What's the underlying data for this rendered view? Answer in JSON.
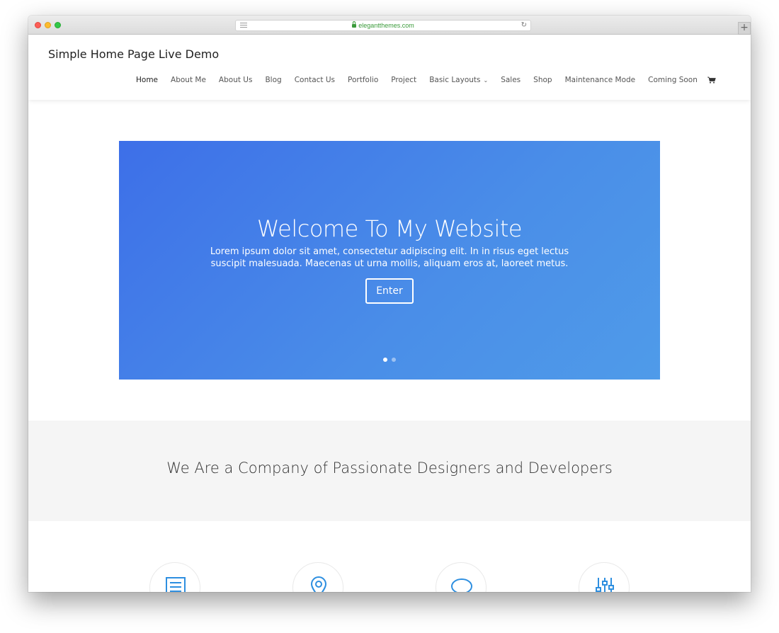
{
  "browser": {
    "url": "elegantthemes.com",
    "new_tab": "+",
    "reload": "↻"
  },
  "site": {
    "title": "Simple Home Page Live Demo"
  },
  "nav": {
    "items": [
      {
        "label": "Home",
        "active": true
      },
      {
        "label": "About Me"
      },
      {
        "label": "About Us"
      },
      {
        "label": "Blog"
      },
      {
        "label": "Contact Us"
      },
      {
        "label": "Portfolio"
      },
      {
        "label": "Project"
      },
      {
        "label": "Basic Layouts",
        "has_dropdown": true
      },
      {
        "label": "Sales"
      },
      {
        "label": "Shop"
      },
      {
        "label": "Maintenance Mode"
      },
      {
        "label": "Coming Soon"
      }
    ],
    "dropdown_glyph": "⌄",
    "cart_icon": "cart-icon"
  },
  "hero": {
    "title": "Welcome To My Website",
    "text": "Lorem ipsum dolor sit amet, consectetur adipiscing elit. In in risus eget lectus suscipit malesuada. Maecenas ut urna mollis, aliquam eros at, laoreet metus.",
    "button_label": "Enter",
    "slides": 2,
    "active_slide": 1,
    "gradient_start": "#3d6fe8",
    "gradient_end": "#4f9be9"
  },
  "company": {
    "heading": "We Are a Company of Passionate Designers and Developers"
  },
  "features": [
    {
      "icon": "document-icon"
    },
    {
      "icon": "map-pin-icon"
    },
    {
      "icon": "chat-bubble-icon"
    },
    {
      "icon": "sliders-icon"
    }
  ],
  "colors": {
    "accent": "#2e8fe0",
    "band_bg": "#f5f5f5"
  }
}
